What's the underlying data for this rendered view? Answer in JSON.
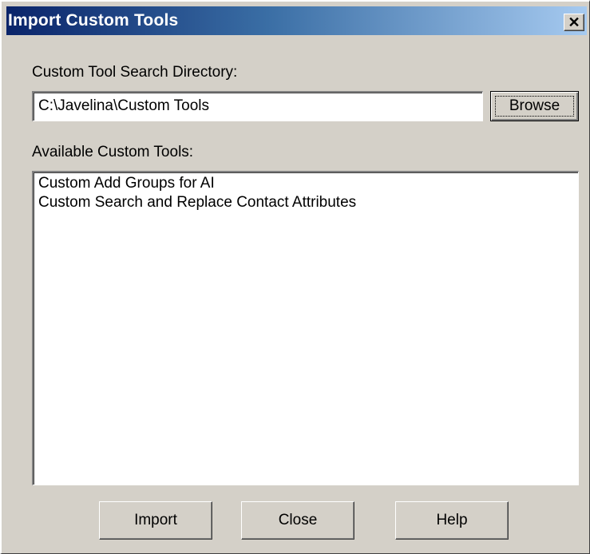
{
  "window": {
    "title": "Import Custom Tools",
    "close_glyph": "✕"
  },
  "directory": {
    "label": "Custom Tool Search Directory:",
    "value": "C:\\Javelina\\Custom Tools",
    "browse_label": "Browse"
  },
  "tools": {
    "label": "Available Custom Tools:",
    "items": [
      {
        "label": "Custom Add Groups for AI"
      },
      {
        "label": "Custom Search and Replace Contact Attributes"
      }
    ]
  },
  "buttons": {
    "import_label": "Import",
    "close_label": "Close",
    "help_label": "Help"
  },
  "colors": {
    "face": "#d4d0c8",
    "title_start": "#0a246a",
    "title_end": "#a6caf0"
  }
}
